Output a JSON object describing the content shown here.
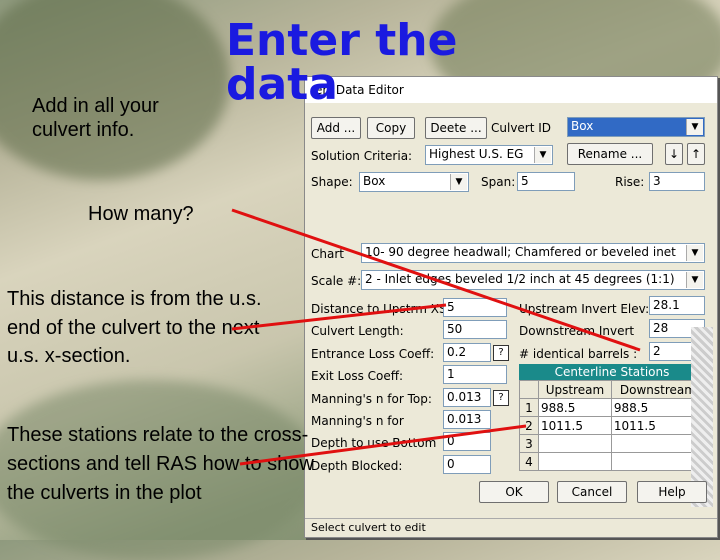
{
  "slide": {
    "title_line1": "Enter the",
    "title_line2": "data",
    "note1": "Add in all your culvert info.",
    "note2": "How many?",
    "note3": "This distance is from the u.s. end of the culvert to the next u.s. x-section.",
    "note4": "These stations relate to the cross-sections and tell RAS how to show the culverts in the plot"
  },
  "dialog": {
    "title": "ert Data Editor",
    "buttons": {
      "add": "Add ...",
      "copy": "Copy",
      "delete": "Deete ...",
      "rename": "Rename ...",
      "ok": "OK",
      "cancel": "Cancel",
      "help": "Help"
    },
    "culvert_id": {
      "label": "Culvert ID",
      "value": "Box"
    },
    "solution_criteria": {
      "label": "Solution Criteria:",
      "value": "Highest U.S. EG"
    },
    "shape": {
      "label": "Shape:",
      "value": "Box"
    },
    "span": {
      "label": "Span:",
      "value": "5"
    },
    "rise": {
      "label": "Rise:",
      "value": "3"
    },
    "chart": {
      "label": "Chart",
      "value": "10- 90 degree headwall; Chamfered or beveled inet"
    },
    "scale": {
      "label": "Scale #:",
      "value": "2 - Inlet edges beveled 1/2 inch at 45 degrees (1:1)"
    },
    "left_fields": [
      {
        "label": "Distance to Upstrm XS:",
        "value": "5"
      },
      {
        "label": "Culvert Length:",
        "value": "50"
      },
      {
        "label": "Entrance Loss Coeff:",
        "value": "0.2"
      },
      {
        "label": "Exit Loss Coeff:",
        "value": "1"
      },
      {
        "label": "Manning's n for Top:",
        "value": "0.013"
      },
      {
        "label": "Manning's n for",
        "value": "0.013"
      },
      {
        "label": "Depth to use Bottom",
        "value": "0"
      },
      {
        "label": "Depth Blocked:",
        "value": "0"
      }
    ],
    "upstream_invert": {
      "label": "Upstream Invert Elev:",
      "value": "28.1"
    },
    "downstream_invert": {
      "label": "Downstream Invert",
      "value": "28"
    },
    "identical_barrels": {
      "label": "# identical barrels :",
      "value": "2"
    },
    "centerline": {
      "title": "Centerline Stations",
      "headers": [
        "Upstream",
        "Downstream"
      ],
      "rows": [
        {
          "n": "1",
          "up": "988.5",
          "down": "988.5"
        },
        {
          "n": "2",
          "up": "1011.5",
          "down": "1011.5"
        },
        {
          "n": "3",
          "up": "",
          "down": ""
        },
        {
          "n": "4",
          "up": "",
          "down": ""
        }
      ]
    },
    "status": "Select culvert to edit"
  },
  "colors": {
    "title": "#1a1ae0",
    "arrow": "#e01010",
    "selection": "#316ac5",
    "header": "#1a8a8a"
  }
}
